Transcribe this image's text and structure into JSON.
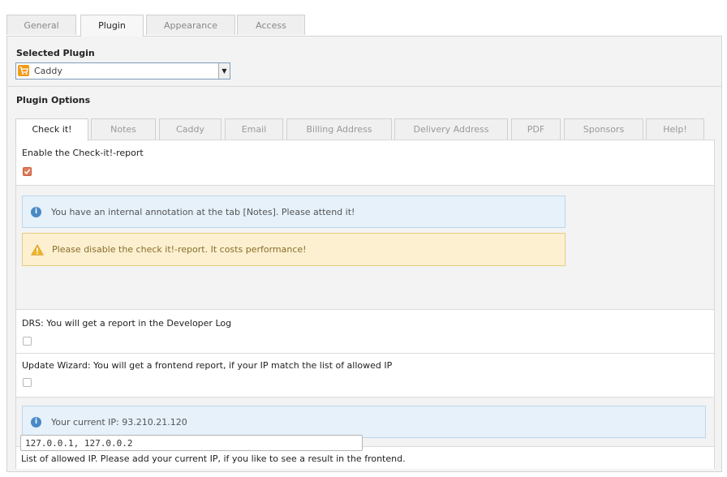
{
  "top_tabs": [
    {
      "label": "General"
    },
    {
      "label": "Plugin",
      "active": true
    },
    {
      "label": "Appearance"
    },
    {
      "label": "Access"
    }
  ],
  "selected_plugin": {
    "label": "Selected Plugin",
    "value": "Caddy",
    "icon": "cart-icon"
  },
  "plugin_options": {
    "label": "Plugin Options",
    "tabs": [
      {
        "label": "Check it!",
        "active": true
      },
      {
        "label": "Notes"
      },
      {
        "label": "Caddy"
      },
      {
        "label": "Email"
      },
      {
        "label": "Billing Address"
      },
      {
        "label": "Delivery Address"
      },
      {
        "label": "PDF"
      },
      {
        "label": "Sponsors"
      },
      {
        "label": "Help!"
      }
    ]
  },
  "check_it": {
    "enable_label": "Enable the Check-it!-report",
    "enable_checked": true,
    "info_annotation": "You have an internal annotation at the tab [Notes]. Please attend it!",
    "warning_performance": "Please disable the check it!-report. It costs performance!",
    "drs_label": "DRS: You will get a report in the Developer Log",
    "drs_checked": false,
    "update_wizard_label": "Update Wizard: You will get a frontend report, if your IP match the list of allowed IP",
    "update_wizard_checked": false,
    "current_ip_info": "Your current IP: 93.210.21.120",
    "allowed_ip_label": "List of allowed IP. Please add your current IP, if you like to see a result in the frontend.",
    "allowed_ip_value": "127.0.0.1, 127.0.0.2"
  },
  "colors": {
    "info_bg": "#e6f1fa",
    "warning_bg": "#fcf0d0",
    "checkbox_checked": "#e07a57"
  }
}
